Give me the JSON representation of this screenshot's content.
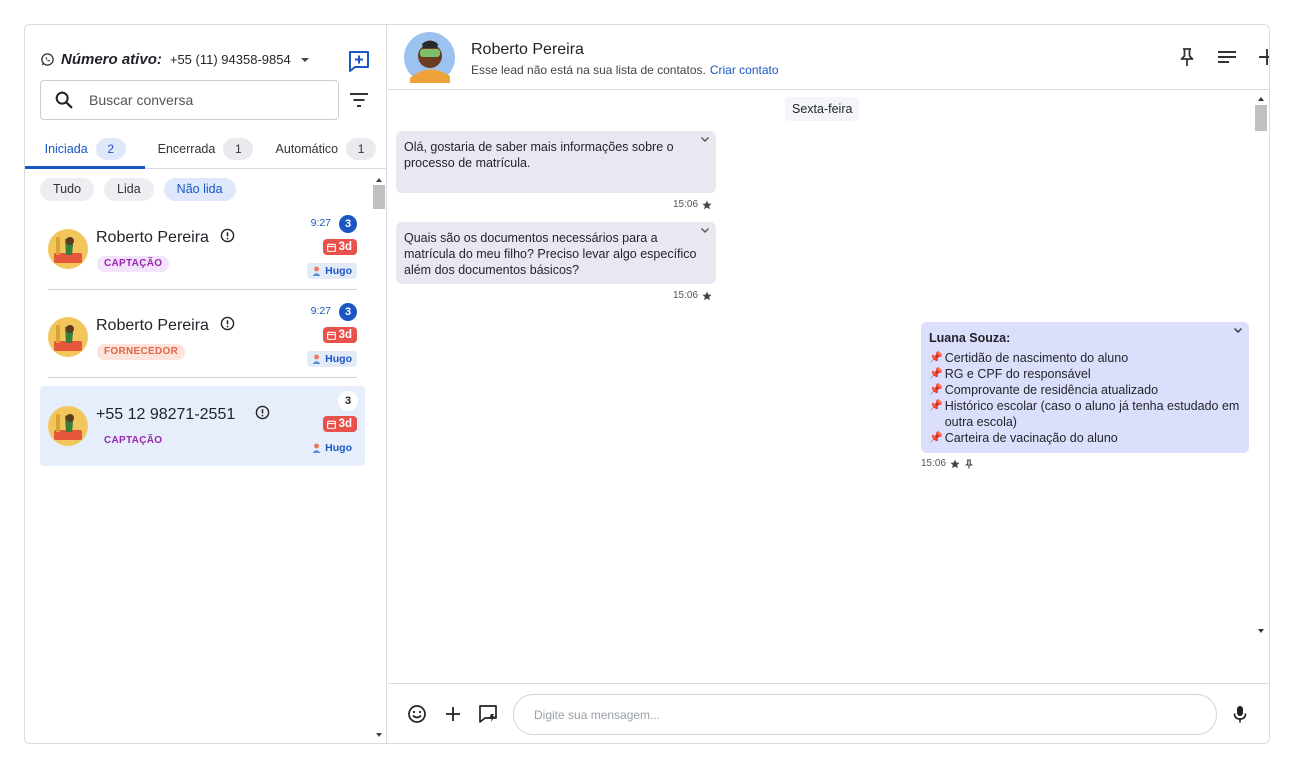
{
  "sidebar": {
    "active_number_label": "Número ativo:",
    "active_number": "+55 (11) 94358-9854",
    "search_placeholder": "Buscar conversa",
    "tabs": [
      {
        "label": "Iniciada",
        "count": "2"
      },
      {
        "label": "Encerrada",
        "count": "1"
      },
      {
        "label": "Automático",
        "count": "1"
      }
    ],
    "chips": [
      "Tudo",
      "Lida",
      "Não lida"
    ],
    "conversations": [
      {
        "name": "Roberto Pereira",
        "tag": "CAPTAÇÃO",
        "time": "9:27",
        "unread": "3",
        "age": "3d",
        "agent": "Hugo"
      },
      {
        "name": "Roberto Pereira",
        "tag": "FORNECEDOR",
        "time": "9:27",
        "unread": "3",
        "age": "3d",
        "agent": "Hugo"
      },
      {
        "name": "+55 12 98271-2551",
        "tag": "CAPTAÇÃO",
        "time": "",
        "unread": "3",
        "age": "3d",
        "agent": "Hugo"
      }
    ]
  },
  "chat": {
    "contact_name": "Roberto Pereira",
    "subtitle": "Esse lead não está na sua lista de contatos.",
    "create_contact": "Criar contato",
    "day_label": "Sexta-feira",
    "messages": [
      {
        "text": "Olá, gostaria de saber mais informações sobre o processo de matrícula.",
        "time": "15:06"
      },
      {
        "text": "Quais são os documentos necessários para a matrícula do meu filho? Preciso levar algo específico além dos documentos básicos?",
        "time": "15:06"
      },
      {
        "author": "Luana Souza:",
        "items": [
          "Certidão de nascimento do aluno",
          "RG e CPF do responsável",
          "Comprovante de residência atualizado",
          "Histórico escolar (caso o aluno já tenha estudado em outra escola)",
          "Carteira de vacinação do aluno"
        ],
        "time": "15:06"
      }
    ],
    "composer_placeholder": "Digite sua mensagem..."
  },
  "colors": {
    "accent": "#1a56c4",
    "age_badge": "#e8524b",
    "incoming_bubble": "#e9e8f1",
    "outgoing_bubble": "#dcdffb"
  }
}
